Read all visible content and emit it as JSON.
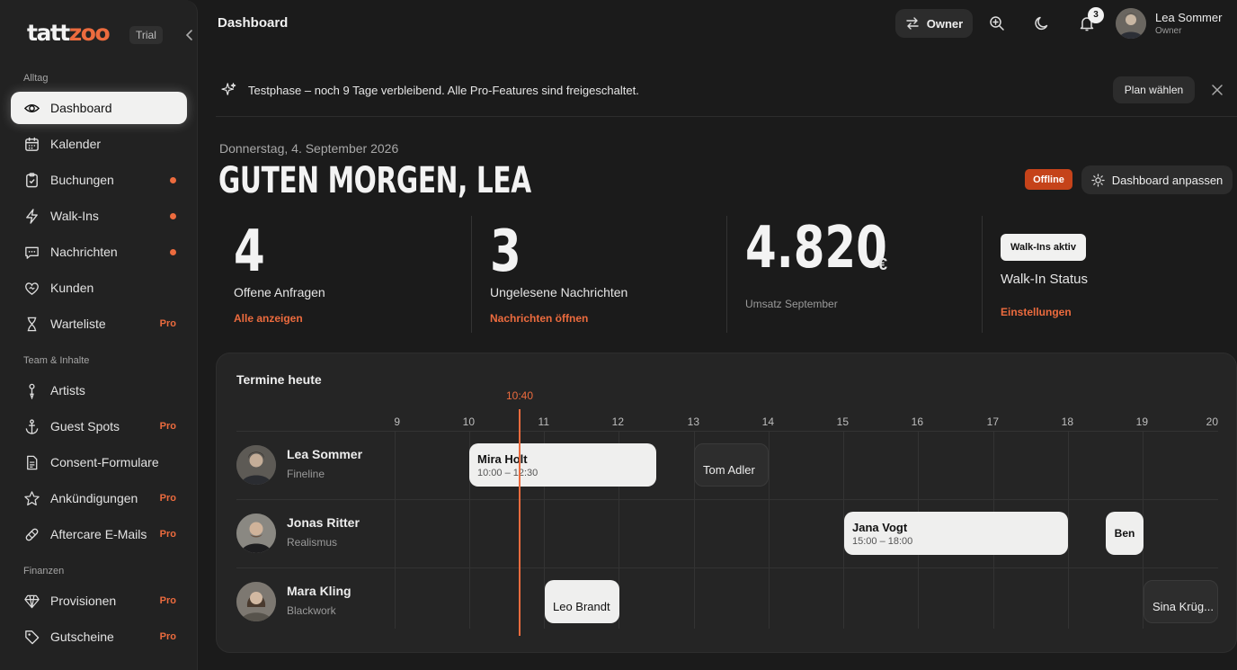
{
  "sidebar": {
    "logo_start": "tatt",
    "logo_accent": "zoo",
    "trial_badge": "Trial",
    "sections": {
      "alltag": "Alltag",
      "team": "Team & Inhalte",
      "finanzen": "Finanzen"
    },
    "items": [
      {
        "label": "Dashboard",
        "icon": "eye-icon",
        "active": true
      },
      {
        "label": "Kalender",
        "icon": "calendar-icon",
        "dot": false
      },
      {
        "label": "Buchungen",
        "icon": "clipboard-icon",
        "dot": true
      },
      {
        "label": "Walk-Ins",
        "icon": "bolt-icon",
        "dot": true
      },
      {
        "label": "Nachrichten",
        "icon": "message-icon",
        "dot": true
      },
      {
        "label": "Kunden",
        "icon": "heart-icon"
      },
      {
        "label": "Warteliste",
        "icon": "hourglass-icon",
        "pro": "Pro"
      },
      {
        "label": "Artists",
        "icon": "needle-icon"
      },
      {
        "label": "Guest Spots",
        "icon": "anchor-icon",
        "pro": "Pro"
      },
      {
        "label": "Consent-Formulare",
        "icon": "document-icon"
      },
      {
        "label": "Ankündigungen",
        "icon": "star-icon",
        "pro": "Pro"
      },
      {
        "label": "Aftercare E-Mails",
        "icon": "bandage-icon",
        "pro": "Pro"
      },
      {
        "label": "Provisionen",
        "icon": "diamond-icon",
        "pro": "Pro"
      },
      {
        "label": "Gutscheine",
        "icon": "tag-icon",
        "pro": "Pro"
      }
    ]
  },
  "header": {
    "title": "Dashboard",
    "role_switch": "Owner",
    "notifications": "3",
    "user_name": "Lea Sommer",
    "user_role": "Owner"
  },
  "banner": {
    "text": "Testphase – noch 9 Tage verbleibend. Alle Pro-Features sind freigeschaltet.",
    "cta": "Plan wählen"
  },
  "main": {
    "date": "Donnerstag, 4. September 2026",
    "greeting": "GUTEN MORGEN, LEA",
    "status_badge": "Offline",
    "customize_btn": "Dashboard anpassen"
  },
  "stats": [
    {
      "value": "4",
      "label": "Offene Anfragen",
      "link": "Alle anzeigen"
    },
    {
      "value": "3",
      "label": "Ungelesene Nachrichten",
      "link": "Nachrichten öffnen"
    },
    {
      "value": "4.820",
      "unit": "€",
      "label": "Umsatz September"
    },
    {
      "chip": "Walk-Ins aktiv",
      "label": "Walk-In Status",
      "link": "Einstellungen"
    }
  ],
  "schedule": {
    "title": "Termine heute",
    "now": "10:40",
    "hours": [
      "9",
      "10",
      "11",
      "12",
      "13",
      "14",
      "15",
      "16",
      "17",
      "18",
      "19",
      "20"
    ],
    "artists": [
      {
        "name": "Lea Sommer",
        "style": "Fineline"
      },
      {
        "name": "Jonas Ritter",
        "style": "Realismus"
      },
      {
        "name": "Mara Kling",
        "style": "Blackwork"
      }
    ],
    "appointments": [
      {
        "name": "Mira Holt",
        "time": "10:00 – 12:30"
      },
      {
        "name": "Tom Adler"
      },
      {
        "name": "Jana Vogt",
        "time": "15:00 – 18:00"
      },
      {
        "name": "Ben"
      },
      {
        "name": "Leo Brandt"
      },
      {
        "name": "Sina Krüg..."
      }
    ]
  }
}
